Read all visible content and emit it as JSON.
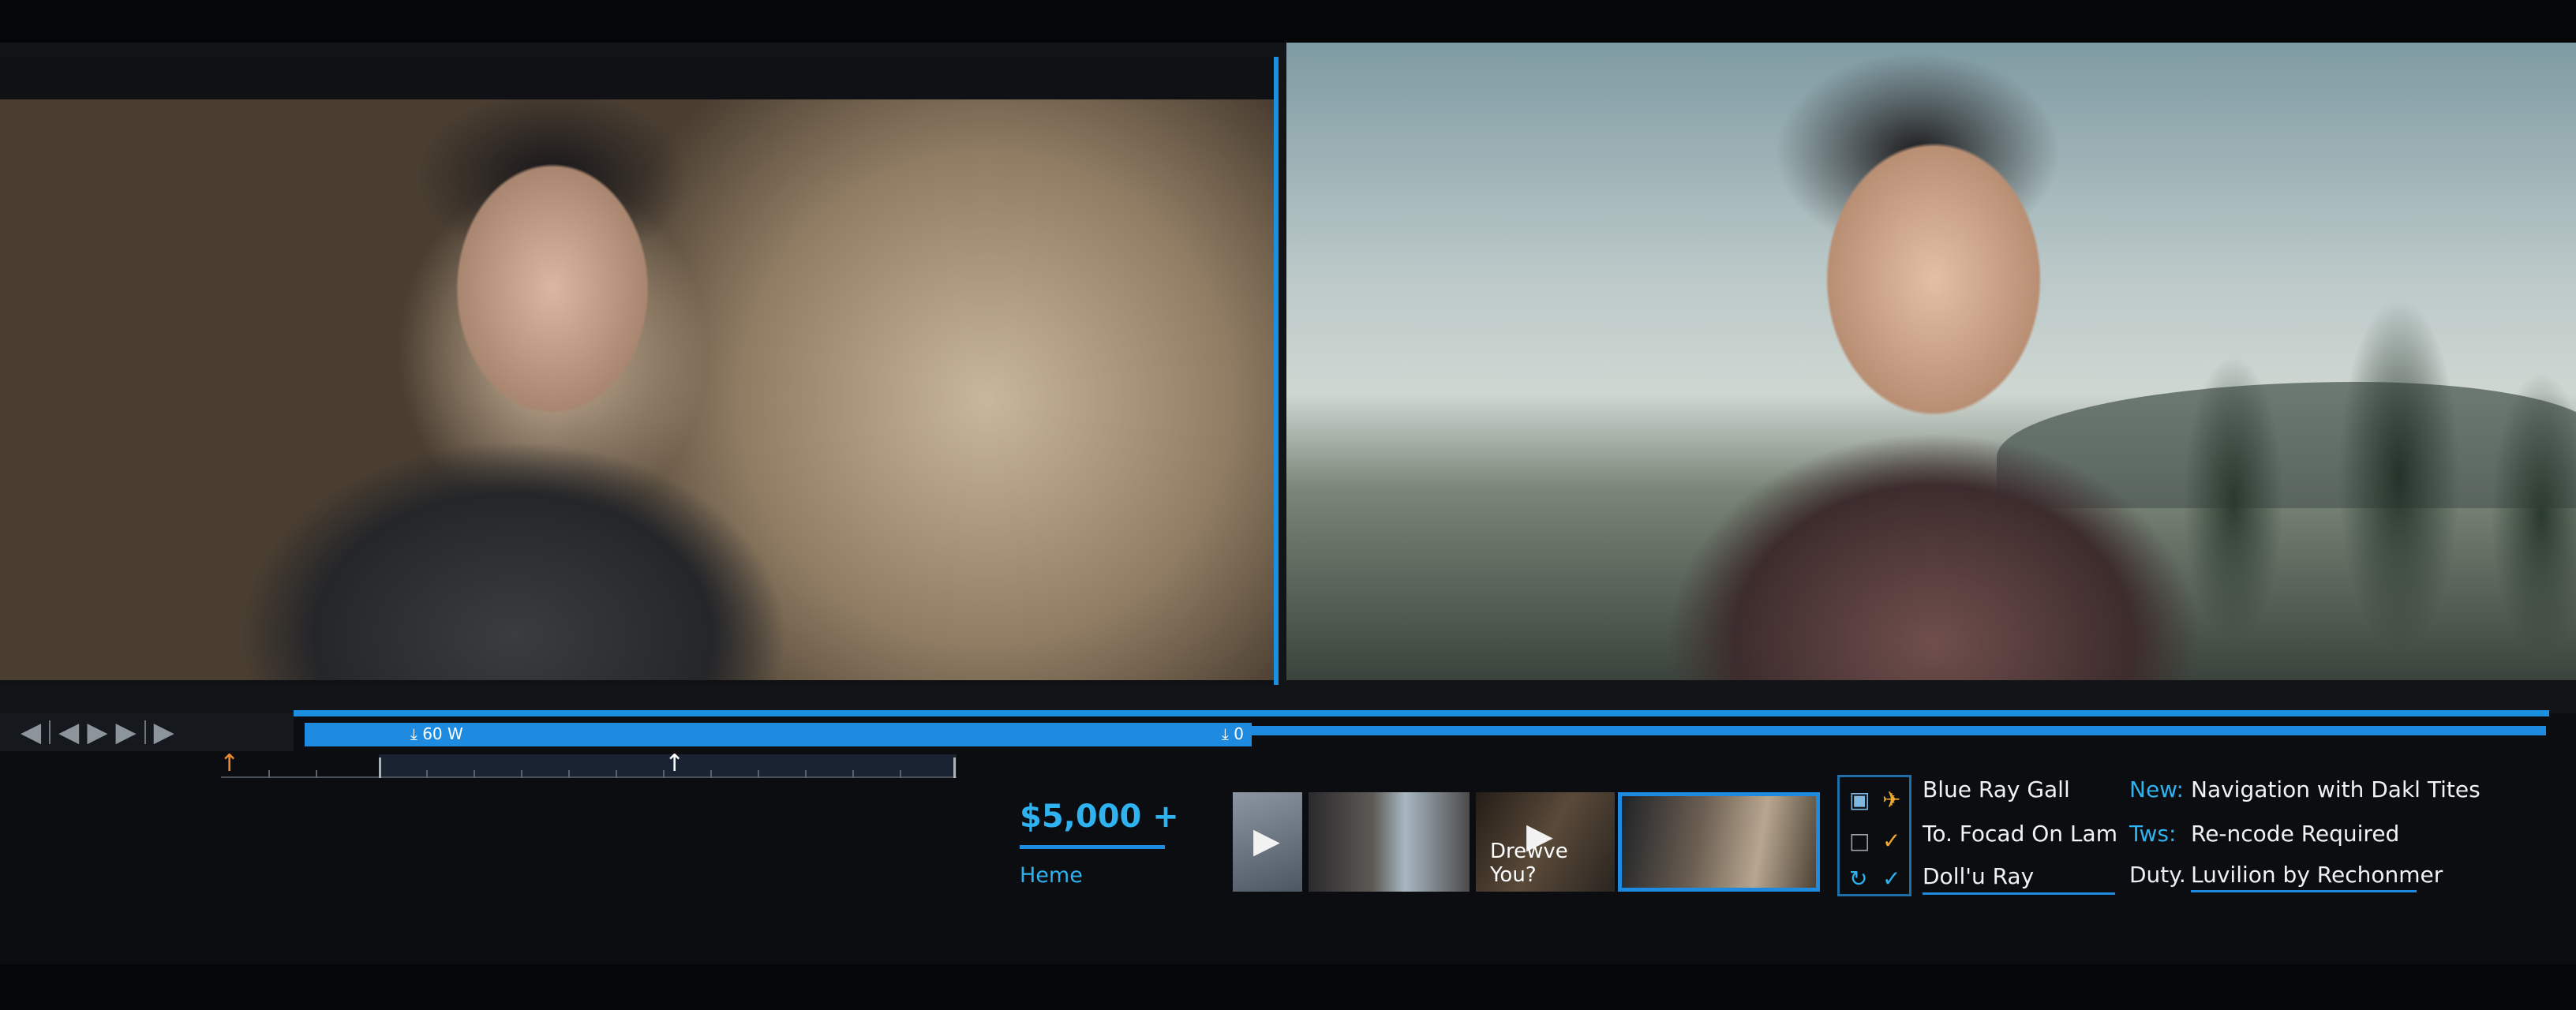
{
  "timeline": {
    "track_label_left": "⤓ 60 W",
    "track_label_right": "⤓ 0"
  },
  "transport": {
    "skip_back": "◀",
    "step_back": "◀",
    "play": "▶",
    "step_forward": "▶",
    "skip_forward": "▶"
  },
  "info": {
    "price": "$5,000 +",
    "home": "Heme"
  },
  "thumbnails": {
    "caption": "Drewve You?",
    "play_icon": "▶"
  },
  "actions": [
    {
      "label": "Blue Ray Gall",
      "icon_a": "book-icon",
      "icon_b": "plane-icon"
    },
    {
      "label": "To. Focad On Lam",
      "icon_a": "clipboard-icon",
      "icon_b": "wrench-icon"
    },
    {
      "label": "Doll'u Ray",
      "icon_a": "refresh-icon",
      "icon_b": "check-icon"
    }
  ],
  "details": [
    {
      "key": "New:",
      "value": "Navigation with Dakl Tites",
      "key_color": "#2fb2f0"
    },
    {
      "key": "Tws:",
      "value": "Re-ncode Required",
      "key_color": "#2fb2f0"
    },
    {
      "key": "Duty.",
      "value": "Luvilion by Rechonmer",
      "key_color": "#e8eef4"
    }
  ],
  "colors": {
    "accent": "#1f8be0",
    "accent_text": "#2fb2f0",
    "marker": "#f08a2a"
  }
}
